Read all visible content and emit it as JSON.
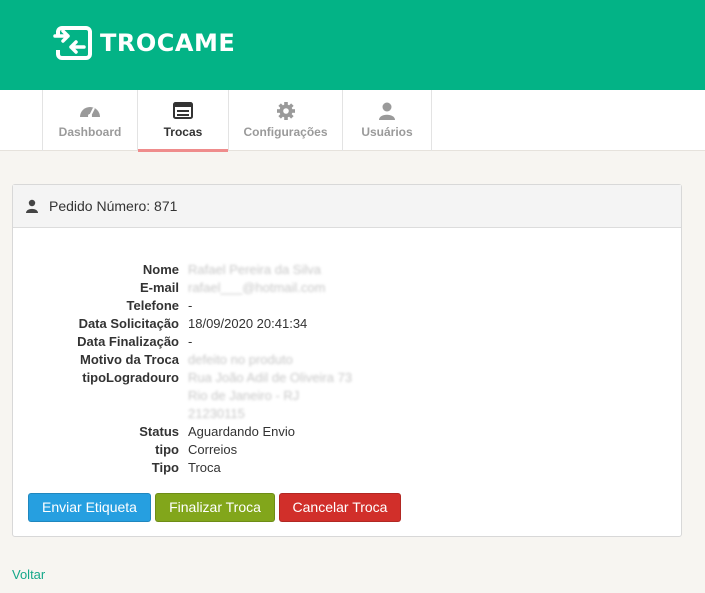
{
  "brand": {
    "name": "TROCAME",
    "color": "#03b386"
  },
  "nav": {
    "tabs": [
      {
        "label": "Dashboard",
        "icon": "dashboard-gauge-icon",
        "active": false
      },
      {
        "label": "Trocas",
        "icon": "list-window-icon",
        "active": true
      },
      {
        "label": "Configurações",
        "icon": "gear-icon",
        "active": false
      },
      {
        "label": "Usuários",
        "icon": "user-icon",
        "active": false
      }
    ]
  },
  "panel": {
    "title": "Pedido Número: 871",
    "fields": [
      {
        "key": "Nome",
        "value": "Rafael Pereira da Silva"
      },
      {
        "key": "E-mail",
        "value": "rafael___@hotmail.com"
      },
      {
        "key": "Telefone",
        "value": "-"
      },
      {
        "key": "Data Solicitação",
        "value": "18/09/2020 20:41:34"
      },
      {
        "key": "Data Finalização",
        "value": "-"
      },
      {
        "key": "Motivo da Troca",
        "value": "defeito no produto"
      },
      {
        "key": "tipoLogradouro",
        "value": "Rua João Adil de Oliveira 73",
        "extra": [
          "Rio de Janeiro - RJ",
          "21230115"
        ]
      },
      {
        "key": "Status",
        "value": "Aguardando Envio"
      },
      {
        "key": "tipo",
        "value": "Correios"
      },
      {
        "key": "Tipo",
        "value": "Troca"
      }
    ]
  },
  "actions": {
    "send_label": "Enviar Etiqueta",
    "finish_label": "Finalizar Troca",
    "cancel_label": "Cancelar Troca"
  },
  "back_label": "Voltar"
}
